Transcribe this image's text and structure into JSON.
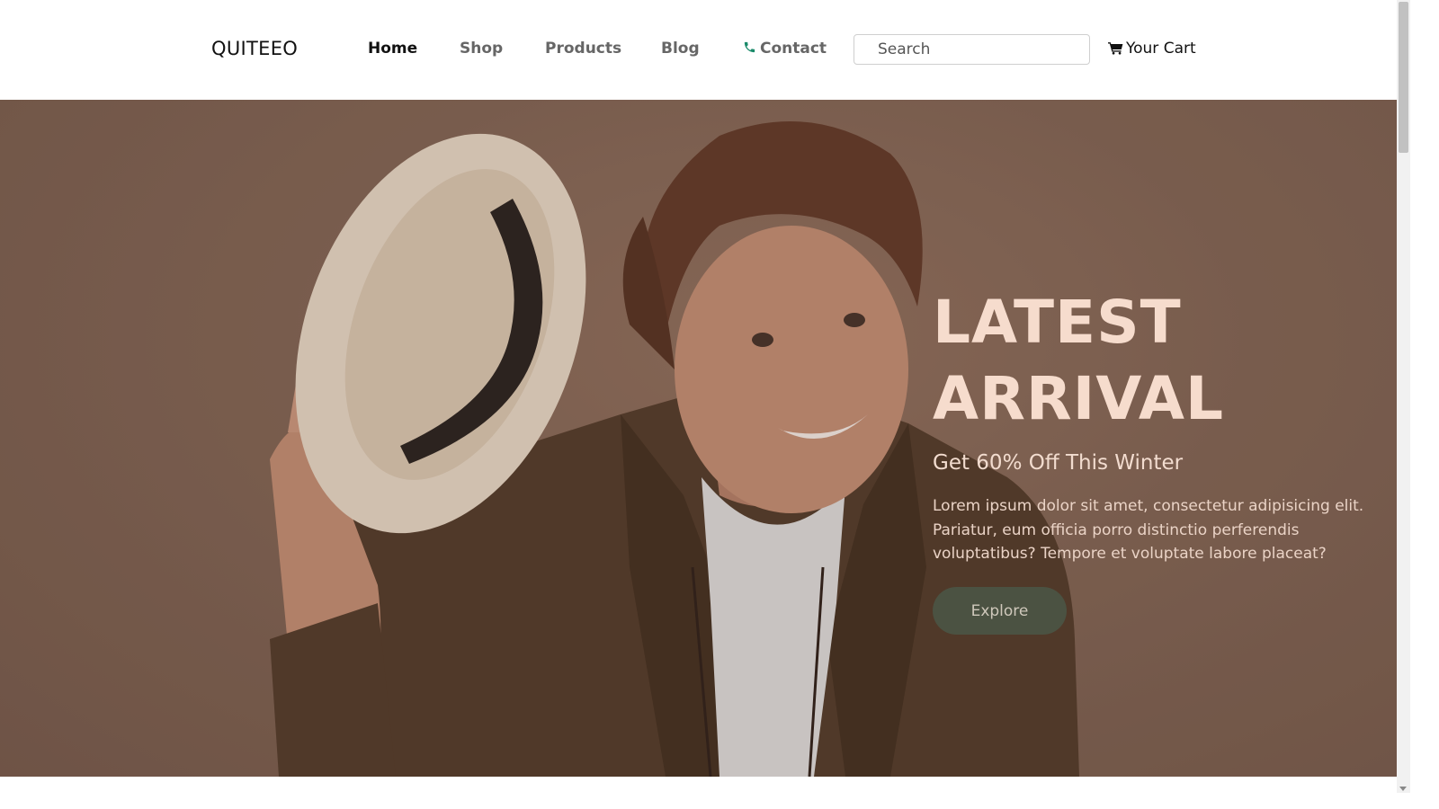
{
  "brand": "QUITEEO",
  "nav": {
    "home": "Home",
    "shop": "Shop",
    "products": "Products",
    "blog": "Blog",
    "contact": "Contact",
    "contact_icon": "phone-icon"
  },
  "search": {
    "placeholder": "Search",
    "value": ""
  },
  "cart": {
    "label": "Your Cart",
    "icon": "shopping-cart-icon"
  },
  "hero": {
    "title_line1": "LATEST",
    "title_line2": "ARRIVAL",
    "subtitle": "Get 60% Off This Winter",
    "body": "Lorem ipsum dolor sit amet, consectetur adipisicing elit. Pariatur, eum officia porro distinctio perferendis voluptatibus? Tempore et voluptate labore placeat?",
    "button_label": "Explore"
  },
  "colors": {
    "hero_bg": "#7b5f4f",
    "hero_title": "#f6dccd",
    "button_bg": "#4b5242",
    "phone_icon": "#1a8a6a"
  }
}
